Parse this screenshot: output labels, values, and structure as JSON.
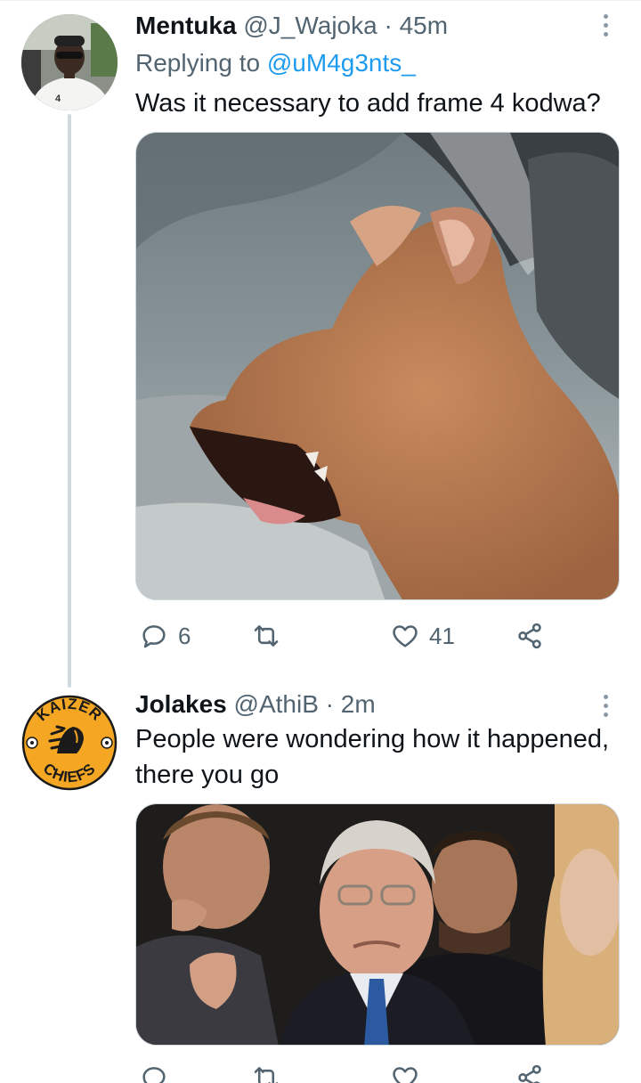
{
  "tweets": [
    {
      "name": "Mentuka",
      "handle": "@J_Wajoka",
      "separator": "·",
      "time": "45m",
      "replying_prefix": "Replying to ",
      "replying_handle": "@uM4g3nts_",
      "text": "Was it necessary to add frame 4 kodwa?",
      "media_description": "photo",
      "avatar_icon": "profile-photo",
      "reply_count": "6",
      "retweet_count": "",
      "like_count": "41"
    },
    {
      "name": "Jolakes",
      "handle": "@AthiB",
      "separator": "·",
      "time": "2m",
      "text": "People were wondering how it happened, there you go",
      "media_description": "photo",
      "avatar_icon": "kaizer-chiefs-logo",
      "avatar_logo_text_top": "KAIZER",
      "avatar_logo_text_bottom": "CHIEFS",
      "reply_count": "",
      "retweet_count": "",
      "like_count": ""
    }
  ],
  "icons": {
    "reply": "reply-icon",
    "retweet": "retweet-icon",
    "like": "heart-icon",
    "share": "share-icon",
    "more": "more-options-icon"
  },
  "colors": {
    "link": "#1d9bf0",
    "secondary_text": "#536471",
    "thread_line": "#cfd9de",
    "chiefs_gold": "#f5a623"
  }
}
